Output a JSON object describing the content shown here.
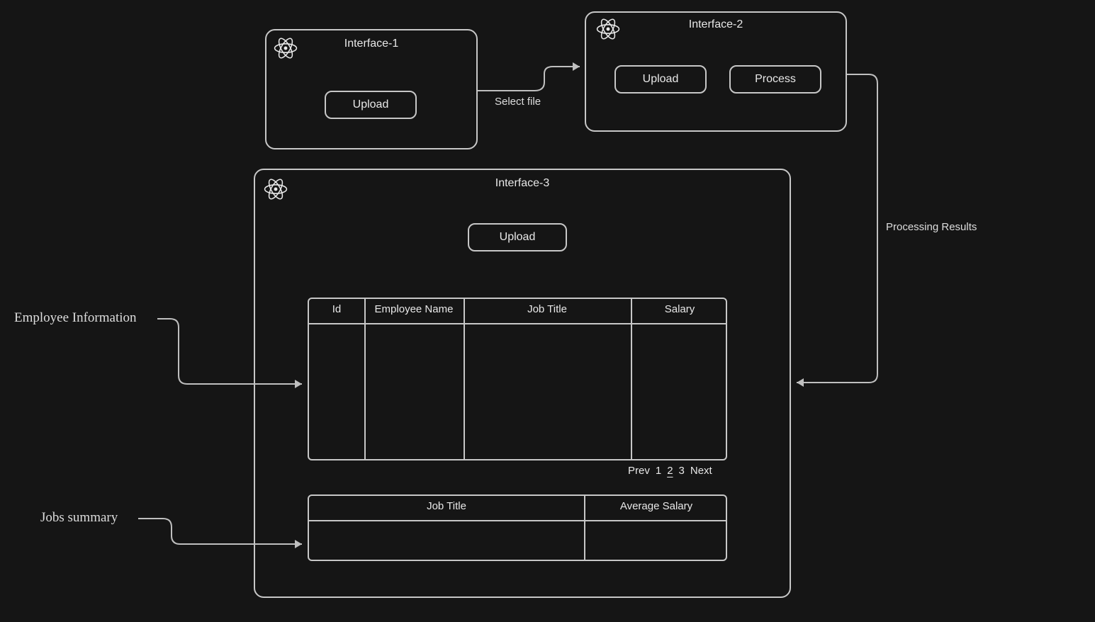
{
  "interface1": {
    "title": "Interface-1",
    "upload_label": "Upload",
    "icon": "react-icon"
  },
  "interface2": {
    "title": "Interface-2",
    "upload_label": "Upload",
    "process_label": "Process",
    "icon": "react-icon"
  },
  "interface3": {
    "title": "Interface-3",
    "upload_label": "Upload",
    "icon": "react-icon",
    "employee_table": {
      "headers": [
        "Id",
        "Employee Name",
        "Job Title",
        "Salary"
      ]
    },
    "pagination": {
      "prev": "Prev",
      "pages": [
        "1",
        "2",
        "3"
      ],
      "current_index": 1,
      "next": "Next"
    },
    "jobs_table": {
      "headers": [
        "Job Title",
        "Average Salary"
      ]
    }
  },
  "connectors": {
    "select_file": "Select file",
    "processing_results": "Processing Results"
  },
  "annotations": {
    "employee_info": "Employee Information",
    "jobs_summary": "Jobs summary"
  }
}
